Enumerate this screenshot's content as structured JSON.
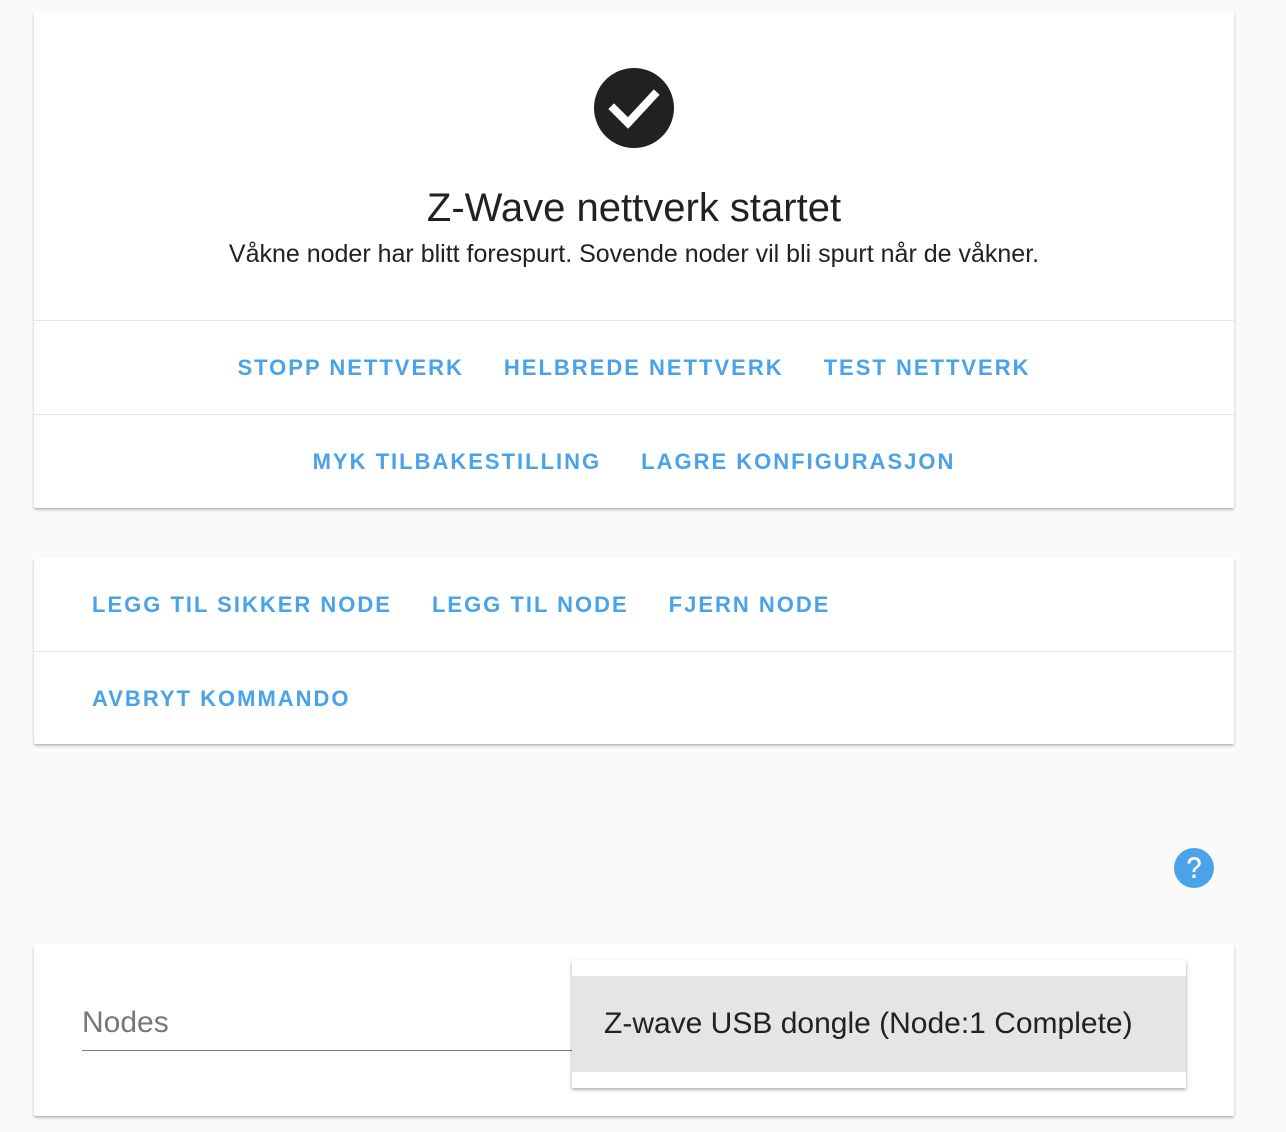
{
  "status": {
    "icon": "check-circle-icon",
    "title": "Z-Wave nettverk startet",
    "subtitle": "Våkne noder har blitt forespurt. Sovende noder vil bli spurt når de våkner."
  },
  "network_actions": {
    "row1": [
      "Stopp nettverk",
      "Helbrede nettverk",
      "Test nettverk"
    ],
    "row2": [
      "Myk tilbakestilling",
      "Lagre konfigurasjon"
    ]
  },
  "node_actions": {
    "row1": [
      "Legg til sikker node",
      "Legg til node",
      "Fjern node"
    ],
    "row2": [
      "Avbryt kommando"
    ]
  },
  "help": {
    "icon": "help-circle-icon",
    "color": "#4aa3e8"
  },
  "nodes": {
    "label": "Nodes",
    "options": [
      "Z-wave USB dongle (Node:1 Complete)"
    ]
  },
  "colors": {
    "accent": "#4aa3e8",
    "icon_dark": "#212121"
  }
}
